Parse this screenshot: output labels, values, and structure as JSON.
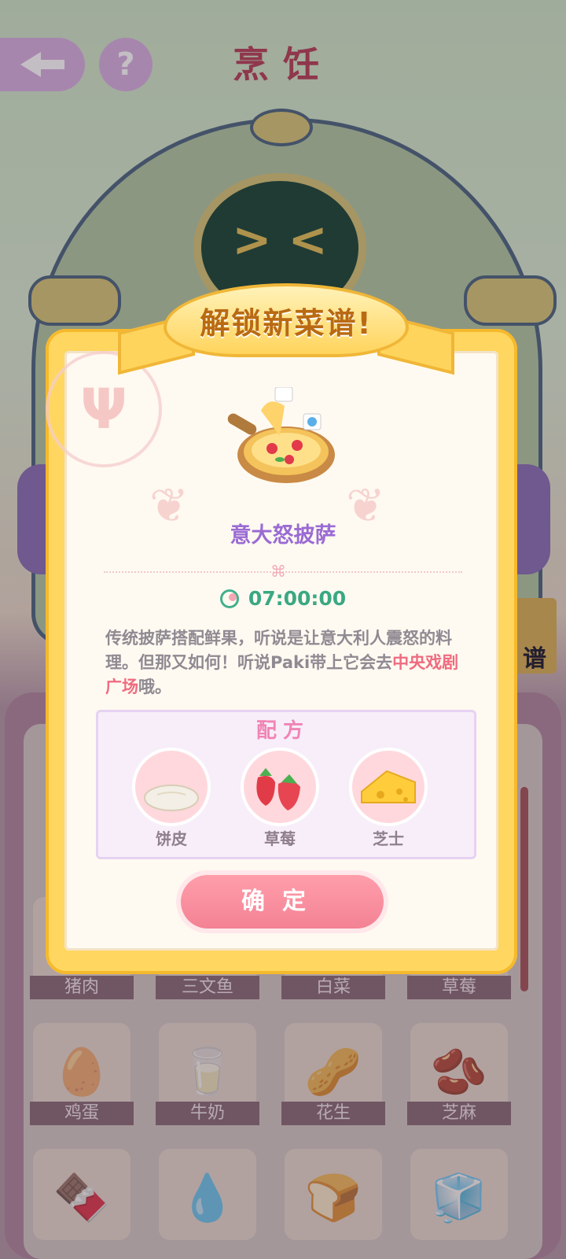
{
  "header": {
    "back_icon": "back-arrow-icon",
    "help_label": "?",
    "title": "烹饪"
  },
  "recipe_tab_label": "谱",
  "ingredient_grid": [
    {
      "label": "猪肉",
      "icon": "🥩"
    },
    {
      "label": "三文鱼",
      "icon": "🐟"
    },
    {
      "label": "白菜",
      "icon": "🥬"
    },
    {
      "label": "草莓",
      "icon": "🍓"
    },
    {
      "label": "鸡蛋",
      "icon": "🥚"
    },
    {
      "label": "牛奶",
      "icon": "🥛"
    },
    {
      "label": "花生",
      "icon": "🥜"
    },
    {
      "label": "芝麻",
      "icon": "🫘"
    },
    {
      "label": "",
      "icon": "🍫"
    },
    {
      "label": "",
      "icon": "💧"
    },
    {
      "label": "",
      "icon": "🍞"
    },
    {
      "label": "",
      "icon": "🧊"
    }
  ],
  "dialog": {
    "banner": "解锁新菜谱!",
    "dish_name": "意大怒披萨",
    "time": "07:00:00",
    "description_parts": {
      "before": "传统披萨搭配鲜果，听说是让意大利人震怒的料理。但那又如何！听说Paki带上它会去",
      "highlight": "中央戏剧广场",
      "after": "哦。"
    },
    "recipe_title": "配方",
    "ingredients": [
      {
        "name": "饼皮",
        "icon": "dough-icon"
      },
      {
        "name": "草莓",
        "icon": "strawberry-icon"
      },
      {
        "name": "芝士",
        "icon": "cheese-icon"
      }
    ],
    "confirm_label": "确定"
  },
  "colors": {
    "dialog_frame": "#ffd760",
    "dish_name": "#9a6bd4",
    "timer": "#3aa883",
    "highlight": "#ef6b7f",
    "confirm_button": "#f38294"
  }
}
